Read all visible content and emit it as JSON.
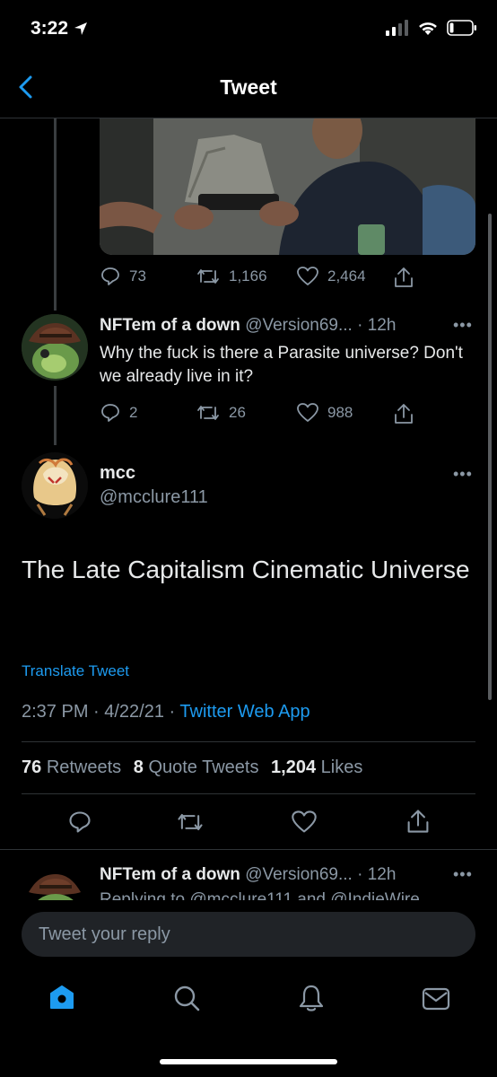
{
  "status_bar": {
    "time": "3:22"
  },
  "header": {
    "title": "Tweet"
  },
  "prev_tweet": {
    "replies": "73",
    "retweets": "1,166",
    "likes": "2,464"
  },
  "reply_tweet": {
    "name": "NFTem of a down",
    "handle": "@Version69...",
    "time": "· 12h",
    "text": "Why the fuck is there a Parasite universe? Don't we already live in it?",
    "replies": "2",
    "retweets": "26",
    "likes": "988"
  },
  "main_tweet": {
    "name": "mcc",
    "handle": "@mcclure111",
    "text": "The Late Capitalism Cinematic Universe",
    "translate": "Translate Tweet",
    "timestamp": "2:37 PM · 4/22/21 · ",
    "source": "Twitter Web App",
    "retweets_count": "76",
    "retweets_label": "Retweets",
    "quotes_count": "8",
    "quotes_label": "Quote Tweets",
    "likes_count": "1,204",
    "likes_label": "Likes"
  },
  "next_reply": {
    "name": "NFTem of a down",
    "handle": "@Version69...",
    "time": "· 12h",
    "replying": "Replying to @mcclure111 and @IndieWire"
  },
  "reply_box": {
    "placeholder": "Tweet your reply"
  },
  "colors": {
    "accent": "#1d9bf0",
    "background": "#000000",
    "muted": "#8b98a5"
  }
}
